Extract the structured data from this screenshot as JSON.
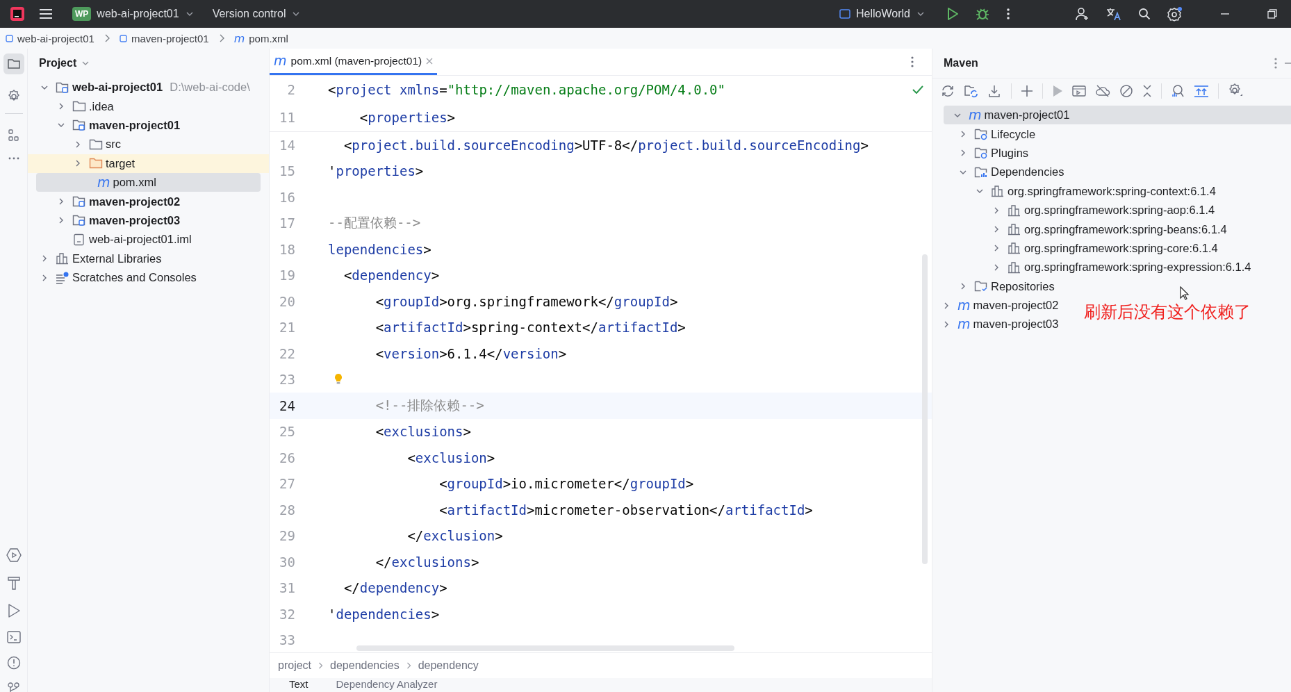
{
  "title_bar": {
    "project_badge": "WP",
    "project": "web-ai-project01",
    "vcs": "Version control",
    "run_config": "HelloWorld"
  },
  "breadcrumbs": [
    {
      "label": "web-ai-project01",
      "kind": "module"
    },
    {
      "label": "maven-project01",
      "kind": "module"
    },
    {
      "label": "pom.xml",
      "kind": "maven",
      "glyph": "m"
    }
  ],
  "project_panel": {
    "title": "Project",
    "tree": [
      {
        "label": "web-ai-project01",
        "path": "D:\\web-ai-code\\",
        "kind": "module",
        "expanded": true,
        "selected": false,
        "children": [
          {
            "label": ".idea",
            "kind": "folder",
            "expanded": false,
            "selected": false
          },
          {
            "label": "maven-project01",
            "kind": "module",
            "expanded": true,
            "selected": false,
            "children": [
              {
                "label": "src",
                "kind": "folder",
                "expanded": false,
                "selected": false
              },
              {
                "label": "target",
                "kind": "excluded-folder",
                "expanded": false,
                "selected": false
              },
              {
                "label": "pom.xml",
                "kind": "maven",
                "glyph": "m",
                "selected": true
              }
            ]
          },
          {
            "label": "maven-project02",
            "kind": "module",
            "expanded": false,
            "selected": false
          },
          {
            "label": "maven-project03",
            "kind": "module",
            "expanded": false,
            "selected": false
          },
          {
            "label": "web-ai-project01.iml",
            "kind": "iml",
            "selected": false
          }
        ]
      },
      {
        "label": "External Libraries",
        "kind": "libraries",
        "expanded": false,
        "selected": false
      },
      {
        "label": "Scratches and Consoles",
        "kind": "scratches",
        "expanded": false,
        "selected": false
      }
    ]
  },
  "editor": {
    "tab": {
      "label": "pom.xml (maven-project01)",
      "glyph": "m",
      "selected": true
    },
    "sticky_lines": [
      {
        "num": "2",
        "tokens": [
          {
            "text": "<",
            "kind": "punct"
          },
          {
            "text": "project",
            "kind": "tag"
          },
          {
            "text": " xmlns",
            "kind": "attr"
          },
          {
            "text": "=",
            "kind": "punct"
          },
          {
            "text": "\"http://maven.apache.org/POM/4.0.0\"",
            "kind": "string"
          }
        ]
      },
      {
        "num": "11",
        "tokens": [
          {
            "text": "    <",
            "kind": "punct"
          },
          {
            "text": "properties",
            "kind": "tag"
          },
          {
            "text": ">",
            "kind": "punct"
          }
        ]
      }
    ],
    "lines": [
      {
        "num": "14",
        "current": false,
        "tokens": [
          {
            "text": "  <",
            "kind": "punct"
          },
          {
            "text": "project.build.sourceEncoding",
            "kind": "tag"
          },
          {
            "text": ">UTF-8</",
            "kind": "punct"
          },
          {
            "text": "project.build.sourceEncoding",
            "kind": "tag"
          },
          {
            "text": ">",
            "kind": "punct"
          }
        ]
      },
      {
        "num": "15",
        "current": false,
        "tokens": [
          {
            "text": "'",
            "kind": "punct"
          },
          {
            "text": "properties",
            "kind": "tag"
          },
          {
            "text": ">",
            "kind": "punct"
          }
        ]
      },
      {
        "num": "16",
        "current": false
      },
      {
        "num": "17",
        "current": false,
        "tokens": [
          {
            "text": "--配置依赖-->",
            "kind": "comment"
          }
        ]
      },
      {
        "num": "18",
        "current": false,
        "tokens": [
          {
            "text": "lependencies",
            "kind": "tag"
          },
          {
            "text": ">",
            "kind": "punct"
          }
        ]
      },
      {
        "num": "19",
        "current": false,
        "tokens": [
          {
            "text": "  <",
            "kind": "punct"
          },
          {
            "text": "dependency",
            "kind": "tag"
          },
          {
            "text": ">",
            "kind": "punct"
          }
        ]
      },
      {
        "num": "20",
        "current": false,
        "tokens": [
          {
            "text": "      <",
            "kind": "punct"
          },
          {
            "text": "groupId",
            "kind": "tag"
          },
          {
            "text": ">org.springframework</",
            "kind": "punct"
          },
          {
            "text": "groupId",
            "kind": "tag"
          },
          {
            "text": ">",
            "kind": "punct"
          }
        ]
      },
      {
        "num": "21",
        "current": false,
        "tokens": [
          {
            "text": "      <",
            "kind": "punct"
          },
          {
            "text": "artifactId",
            "kind": "tag"
          },
          {
            "text": ">spring-context</",
            "kind": "punct"
          },
          {
            "text": "artifactId",
            "kind": "tag"
          },
          {
            "text": ">",
            "kind": "punct"
          }
        ]
      },
      {
        "num": "22",
        "current": false,
        "tokens": [
          {
            "text": "      <",
            "kind": "punct"
          },
          {
            "text": "version",
            "kind": "tag"
          },
          {
            "text": ">6.1.4</",
            "kind": "punct"
          },
          {
            "text": "version",
            "kind": "tag"
          },
          {
            "text": ">",
            "kind": "punct"
          }
        ]
      },
      {
        "num": "23",
        "current": false,
        "bulb": true
      },
      {
        "num": "24",
        "current": true,
        "tokens": [
          {
            "text": "      <!--排除依赖-->",
            "kind": "comment"
          }
        ]
      },
      {
        "num": "25",
        "current": false,
        "tokens": [
          {
            "text": "      <",
            "kind": "punct"
          },
          {
            "text": "exclusions",
            "kind": "tag"
          },
          {
            "text": ">",
            "kind": "punct"
          }
        ]
      },
      {
        "num": "26",
        "current": false,
        "tokens": [
          {
            "text": "          <",
            "kind": "punct"
          },
          {
            "text": "exclusion",
            "kind": "tag"
          },
          {
            "text": ">",
            "kind": "punct"
          }
        ]
      },
      {
        "num": "27",
        "current": false,
        "tokens": [
          {
            "text": "              <",
            "kind": "punct"
          },
          {
            "text": "groupId",
            "kind": "tag"
          },
          {
            "text": ">io.micrometer</",
            "kind": "punct"
          },
          {
            "text": "groupId",
            "kind": "tag"
          },
          {
            "text": ">",
            "kind": "punct"
          }
        ]
      },
      {
        "num": "28",
        "current": false,
        "tokens": [
          {
            "text": "              <",
            "kind": "punct"
          },
          {
            "text": "artifactId",
            "kind": "tag"
          },
          {
            "text": ">micrometer-observation</",
            "kind": "punct"
          },
          {
            "text": "artifactId",
            "kind": "tag"
          },
          {
            "text": ">",
            "kind": "punct"
          }
        ]
      },
      {
        "num": "29",
        "current": false,
        "tokens": [
          {
            "text": "          </",
            "kind": "punct"
          },
          {
            "text": "exclusion",
            "kind": "tag"
          },
          {
            "text": ">",
            "kind": "punct"
          }
        ]
      },
      {
        "num": "30",
        "current": false,
        "tokens": [
          {
            "text": "      </",
            "kind": "punct"
          },
          {
            "text": "exclusions",
            "kind": "tag"
          },
          {
            "text": ">",
            "kind": "punct"
          }
        ]
      },
      {
        "num": "31",
        "current": false,
        "tokens": [
          {
            "text": "  </",
            "kind": "punct"
          },
          {
            "text": "dependency",
            "kind": "tag"
          },
          {
            "text": ">",
            "kind": "punct"
          }
        ]
      },
      {
        "num": "32",
        "current": false,
        "tokens": [
          {
            "text": "'",
            "kind": "punct"
          },
          {
            "text": "dependencies",
            "kind": "tag"
          },
          {
            "text": ">",
            "kind": "punct"
          }
        ]
      },
      {
        "num": "33",
        "current": false
      }
    ],
    "path": [
      "project",
      "dependencies",
      "dependency"
    ],
    "bottom_tabs": [
      {
        "label": "Text",
        "selected": true
      },
      {
        "label": "Dependency Analyzer",
        "selected": false
      }
    ]
  },
  "maven_panel": {
    "title": "Maven",
    "tree": [
      {
        "label": "maven-project01",
        "kind": "maven",
        "glyph": "m",
        "expanded": true,
        "selected": true,
        "children": [
          {
            "label": "Lifecycle",
            "kind": "gear-folder",
            "expanded": false,
            "selected": false
          },
          {
            "label": "Plugins",
            "kind": "gear-folder",
            "expanded": false,
            "selected": false
          },
          {
            "label": "Dependencies",
            "kind": "deps-folder",
            "expanded": true,
            "selected": false,
            "children": [
              {
                "label": "org.springframework:spring-context:6.1.4",
                "kind": "library",
                "expanded": true,
                "selected": false,
                "children": [
                  {
                    "label": "org.springframework:spring-aop:6.1.4",
                    "kind": "library",
                    "expanded": false,
                    "selected": false
                  },
                  {
                    "label": "org.springframework:spring-beans:6.1.4",
                    "kind": "library",
                    "expanded": false,
                    "selected": false
                  },
                  {
                    "label": "org.springframework:spring-core:6.1.4",
                    "kind": "library",
                    "expanded": false,
                    "selected": false
                  },
                  {
                    "label": "org.springframework:spring-expression:6.1.4",
                    "kind": "library",
                    "expanded": false,
                    "selected": false
                  }
                ]
              }
            ]
          },
          {
            "label": "Repositories",
            "kind": "repo-folder",
            "expanded": false,
            "selected": false
          }
        ]
      },
      {
        "label": "maven-project02",
        "kind": "maven",
        "glyph": "m",
        "expanded": false,
        "selected": false
      },
      {
        "label": "maven-project03",
        "kind": "maven",
        "glyph": "m",
        "expanded": false,
        "selected": false
      }
    ],
    "annotation": "刷新后没有这个依赖了"
  }
}
